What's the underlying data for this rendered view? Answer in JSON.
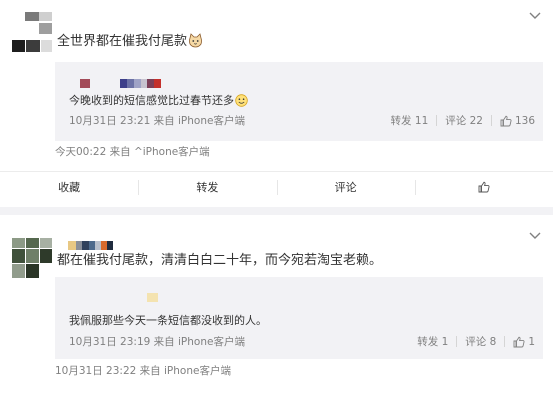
{
  "posts": [
    {
      "text": "全世界都在催我付尾款",
      "emoji_icon": "cat-face-icon",
      "quote": {
        "text": "今晚收到的短信感觉比过春节还多",
        "emoji_icon": "smile-face-icon",
        "time": "10月31日 23:21",
        "source": "来自 iPhone客户端",
        "repost_label": "转发 11",
        "comment_label": "评论 22",
        "like_count": "136"
      },
      "time": "今天00:22",
      "source": "来自 ^iPhone客户端",
      "toolbar": {
        "collect": "收藏",
        "repost": "转发",
        "comment": "评论"
      }
    },
    {
      "text": "都在催我付尾款，清清白白二十年，而今宛若淘宝老赖。",
      "quote": {
        "text": "我佩服那些今天一条短信都没收到的人。",
        "time": "10月31日 23:19",
        "source": "来自 iPhone客户端",
        "repost_label": "转发 1",
        "comment_label": "评论 8",
        "like_count": "1"
      },
      "time": "10月31日 23:22",
      "source": "来自 iPhone客户端"
    }
  ],
  "colors": {
    "text": "#333333",
    "meta": "#808080",
    "quote_bg": "#f2f2f5",
    "separator": "#f2f2f5"
  }
}
